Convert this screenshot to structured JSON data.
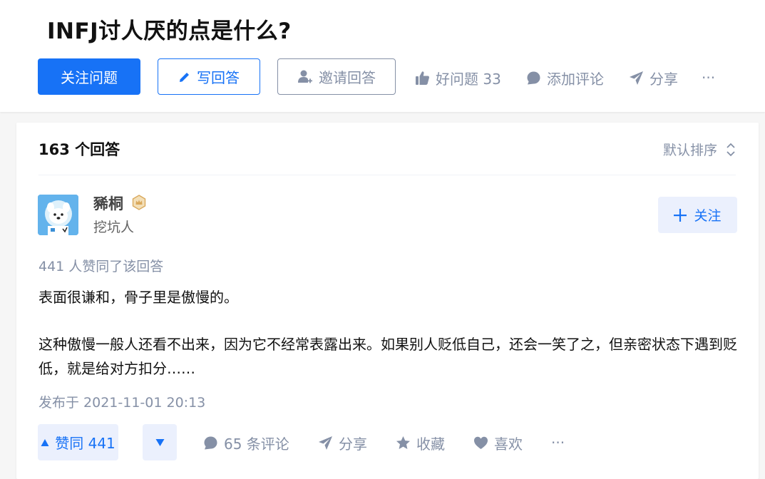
{
  "question": {
    "title": "INFJ讨人厌的点是什么?"
  },
  "question_actions": {
    "follow_label": "关注问题",
    "write_label": "写回答",
    "invite_label": "邀请回答",
    "good_question_label": "好问题 33",
    "comment_label": "添加评论",
    "share_label": "分享",
    "more_label": "···"
  },
  "answers_header": {
    "count_label": "163 个回答",
    "sort_label": "默认排序"
  },
  "answer": {
    "author": {
      "name": "豨桐",
      "bio": "挖坑人",
      "follow_label": "关注"
    },
    "vote_info": "441 人赞同了该回答",
    "paragraphs": [
      "表面很谦和，骨子里是傲慢的。",
      "这种傲慢一般人还看不出来，因为它不经常表露出来。如果别人贬低自己，还会一笑了之，但亲密状态下遇到贬低，就是给对方扣分……"
    ],
    "publish_time": "发布于 2021-11-01 20:13",
    "actions": {
      "upvote_label": "赞同 441",
      "comment_label": "65 条评论",
      "share_label": "分享",
      "collect_label": "收藏",
      "like_label": "喜欢",
      "more_label": "···"
    }
  },
  "colors": {
    "primary": "#1772f6",
    "primary_light": "#ebf0fd",
    "muted": "#8590a6",
    "text": "#121212",
    "background": "#f6f6f6",
    "badge_gold": "#d9a85b"
  }
}
